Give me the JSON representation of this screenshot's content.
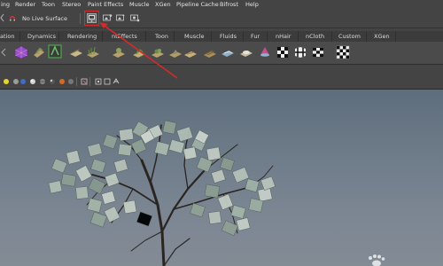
{
  "menubar": {
    "items": [
      "ing",
      "Render",
      "Toon",
      "Stereo",
      "Paint Effects",
      "Muscle",
      "XGen",
      "Pipeline Cache",
      "Bifrost",
      "Help"
    ]
  },
  "statusline": {
    "live_surface_label": "No Live Surface"
  },
  "shelf_tabs": [
    "ation",
    "Dynamics",
    "Rendering",
    "ntEffects",
    "Toon",
    "Muscle",
    "Fluids",
    "Fur",
    "nHair",
    "nCloth",
    "Custom",
    "XGen"
  ],
  "colors": {
    "highlight": "#d42a2a",
    "arrow": "#d42a2a",
    "viewport_top": "#5e6d7c",
    "viewport_bottom": "#838b95"
  },
  "icons": {
    "live_surface": "magnet-icon",
    "highlighted_button": "render-view-icon",
    "watermark": "paw-watermark-icon"
  }
}
